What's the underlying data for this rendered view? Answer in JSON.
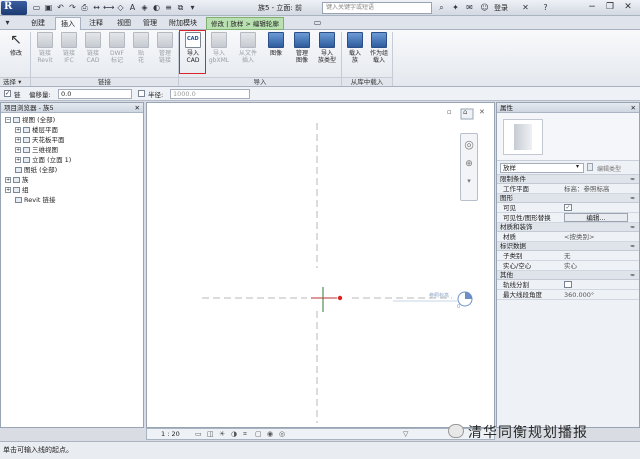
{
  "title_bar": {
    "doc_title": "族5 - 立面: 前",
    "search_placeholder": "键入关键字或短语",
    "login_label": "登录"
  },
  "tabs": [
    "创建",
    "插入",
    "注释",
    "视图",
    "管理",
    "附加模块"
  ],
  "active_tab": "插入",
  "context_tab": "修改 | 放样 > 编辑轮廓",
  "ribbon": {
    "modify_label": "修改",
    "link_buttons": [
      {
        "line1": "链接",
        "line2": "Revit"
      },
      {
        "line1": "链接",
        "line2": "IFC"
      },
      {
        "line1": "链接",
        "line2": "CAD"
      },
      {
        "line1": "DWF",
        "line2": "标记"
      },
      {
        "line1": "贴",
        "line2": "花"
      },
      {
        "line1": "管理",
        "line2": "链接"
      }
    ],
    "import_buttons": [
      {
        "line1": "导入",
        "line2": "CAD"
      },
      {
        "line1": "导入",
        "line2": "gbXML"
      },
      {
        "line1": "从文件",
        "line2": "插入"
      },
      {
        "line1": "图像",
        "line2": ""
      },
      {
        "line1": "管理",
        "line2": "图像"
      },
      {
        "line1": "导入",
        "line2": "族类型"
      }
    ],
    "lib_buttons": [
      {
        "line1": "载入",
        "line2": "族"
      },
      {
        "line1": "作为组",
        "line2": "载入"
      }
    ],
    "groups": {
      "select": "选择 ▾",
      "link": "链接",
      "import": "导入",
      "load_from_lib": "从库中载入"
    }
  },
  "options_bar": {
    "chain_label": "链",
    "offset_label": "偏移量:",
    "offset_value": "0.0",
    "radius_label": "半径:",
    "radius_value": "1000.0"
  },
  "project_browser": {
    "title": "项目浏览器 - 族5",
    "items": [
      {
        "label": "视图 (全部)",
        "indent": 0,
        "toggle": "−"
      },
      {
        "label": "楼层平面",
        "indent": 1,
        "toggle": "+"
      },
      {
        "label": "天花板平面",
        "indent": 1,
        "toggle": "+"
      },
      {
        "label": "三维视图",
        "indent": 1,
        "toggle": "+"
      },
      {
        "label": "立面 (立面 1)",
        "indent": 1,
        "toggle": "+"
      },
      {
        "label": "图纸 (全部)",
        "indent": 0,
        "toggle": ""
      },
      {
        "label": "族",
        "indent": 0,
        "toggle": "+"
      },
      {
        "label": "组",
        "indent": 0,
        "toggle": "+"
      },
      {
        "label": "Revit 链接",
        "indent": 0,
        "toggle": ""
      }
    ]
  },
  "viewport": {
    "ref_label": "参照标高",
    "ref_value": "0"
  },
  "properties": {
    "title": "属性",
    "type_selector": "放样",
    "edit_type_label": "编辑类型",
    "sections": [
      {
        "name": "限制条件",
        "rows": [
          {
            "key": "工作平面",
            "value": "标高：参照标高"
          }
        ]
      },
      {
        "name": "图形",
        "rows": [
          {
            "key": "可见",
            "value": "✓"
          },
          {
            "key": "可见性/图形替换",
            "value": "编辑..."
          }
        ]
      },
      {
        "name": "材质和装饰",
        "rows": [
          {
            "key": "材质",
            "value": "<按类别>"
          }
        ]
      },
      {
        "name": "标识数据",
        "rows": [
          {
            "key": "子类别",
            "value": "无"
          },
          {
            "key": "实心/空心",
            "value": "实心"
          }
        ]
      },
      {
        "name": "其他",
        "rows": [
          {
            "key": "轨线分割",
            "value": ""
          },
          {
            "key": "最大线段角度",
            "value": "360.000°"
          }
        ]
      }
    ],
    "collapse_glyph": "≈"
  },
  "view_control": {
    "scale": "1 : 20"
  },
  "status_text": "单击可输入线的起点。",
  "watermark": "清华同衡规划播报"
}
